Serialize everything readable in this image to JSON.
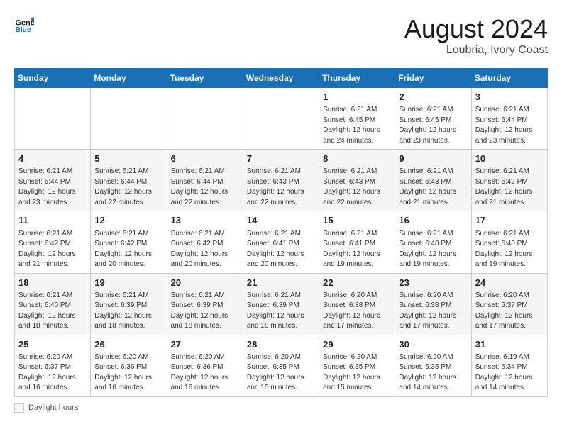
{
  "header": {
    "logo_line1": "General",
    "logo_line2": "Blue",
    "month_year": "August 2024",
    "location": "Loubria, Ivory Coast"
  },
  "days_of_week": [
    "Sunday",
    "Monday",
    "Tuesday",
    "Wednesday",
    "Thursday",
    "Friday",
    "Saturday"
  ],
  "weeks": [
    [
      {
        "day": "",
        "info": ""
      },
      {
        "day": "",
        "info": ""
      },
      {
        "day": "",
        "info": ""
      },
      {
        "day": "",
        "info": ""
      },
      {
        "day": "1",
        "info": "Sunrise: 6:21 AM\nSunset: 6:45 PM\nDaylight: 12 hours\nand 24 minutes."
      },
      {
        "day": "2",
        "info": "Sunrise: 6:21 AM\nSunset: 6:45 PM\nDaylight: 12 hours\nand 23 minutes."
      },
      {
        "day": "3",
        "info": "Sunrise: 6:21 AM\nSunset: 6:44 PM\nDaylight: 12 hours\nand 23 minutes."
      }
    ],
    [
      {
        "day": "4",
        "info": "Sunrise: 6:21 AM\nSunset: 6:44 PM\nDaylight: 12 hours\nand 23 minutes."
      },
      {
        "day": "5",
        "info": "Sunrise: 6:21 AM\nSunset: 6:44 PM\nDaylight: 12 hours\nand 22 minutes."
      },
      {
        "day": "6",
        "info": "Sunrise: 6:21 AM\nSunset: 6:44 PM\nDaylight: 12 hours\nand 22 minutes."
      },
      {
        "day": "7",
        "info": "Sunrise: 6:21 AM\nSunset: 6:43 PM\nDaylight: 12 hours\nand 22 minutes."
      },
      {
        "day": "8",
        "info": "Sunrise: 6:21 AM\nSunset: 6:43 PM\nDaylight: 12 hours\nand 22 minutes."
      },
      {
        "day": "9",
        "info": "Sunrise: 6:21 AM\nSunset: 6:43 PM\nDaylight: 12 hours\nand 21 minutes."
      },
      {
        "day": "10",
        "info": "Sunrise: 6:21 AM\nSunset: 6:42 PM\nDaylight: 12 hours\nand 21 minutes."
      }
    ],
    [
      {
        "day": "11",
        "info": "Sunrise: 6:21 AM\nSunset: 6:42 PM\nDaylight: 12 hours\nand 21 minutes."
      },
      {
        "day": "12",
        "info": "Sunrise: 6:21 AM\nSunset: 6:42 PM\nDaylight: 12 hours\nand 20 minutes."
      },
      {
        "day": "13",
        "info": "Sunrise: 6:21 AM\nSunset: 6:42 PM\nDaylight: 12 hours\nand 20 minutes."
      },
      {
        "day": "14",
        "info": "Sunrise: 6:21 AM\nSunset: 6:41 PM\nDaylight: 12 hours\nand 20 minutes."
      },
      {
        "day": "15",
        "info": "Sunrise: 6:21 AM\nSunset: 6:41 PM\nDaylight: 12 hours\nand 19 minutes."
      },
      {
        "day": "16",
        "info": "Sunrise: 6:21 AM\nSunset: 6:40 PM\nDaylight: 12 hours\nand 19 minutes."
      },
      {
        "day": "17",
        "info": "Sunrise: 6:21 AM\nSunset: 6:40 PM\nDaylight: 12 hours\nand 19 minutes."
      }
    ],
    [
      {
        "day": "18",
        "info": "Sunrise: 6:21 AM\nSunset: 6:40 PM\nDaylight: 12 hours\nand 18 minutes."
      },
      {
        "day": "19",
        "info": "Sunrise: 6:21 AM\nSunset: 6:39 PM\nDaylight: 12 hours\nand 18 minutes."
      },
      {
        "day": "20",
        "info": "Sunrise: 6:21 AM\nSunset: 6:39 PM\nDaylight: 12 hours\nand 18 minutes."
      },
      {
        "day": "21",
        "info": "Sunrise: 6:21 AM\nSunset: 6:39 PM\nDaylight: 12 hours\nand 18 minutes."
      },
      {
        "day": "22",
        "info": "Sunrise: 6:20 AM\nSunset: 6:38 PM\nDaylight: 12 hours\nand 17 minutes."
      },
      {
        "day": "23",
        "info": "Sunrise: 6:20 AM\nSunset: 6:38 PM\nDaylight: 12 hours\nand 17 minutes."
      },
      {
        "day": "24",
        "info": "Sunrise: 6:20 AM\nSunset: 6:37 PM\nDaylight: 12 hours\nand 17 minutes."
      }
    ],
    [
      {
        "day": "25",
        "info": "Sunrise: 6:20 AM\nSunset: 6:37 PM\nDaylight: 12 hours\nand 16 minutes."
      },
      {
        "day": "26",
        "info": "Sunrise: 6:20 AM\nSunset: 6:36 PM\nDaylight: 12 hours\nand 16 minutes."
      },
      {
        "day": "27",
        "info": "Sunrise: 6:20 AM\nSunset: 6:36 PM\nDaylight: 12 hours\nand 16 minutes."
      },
      {
        "day": "28",
        "info": "Sunrise: 6:20 AM\nSunset: 6:35 PM\nDaylight: 12 hours\nand 15 minutes."
      },
      {
        "day": "29",
        "info": "Sunrise: 6:20 AM\nSunset: 6:35 PM\nDaylight: 12 hours\nand 15 minutes."
      },
      {
        "day": "30",
        "info": "Sunrise: 6:20 AM\nSunset: 6:35 PM\nDaylight: 12 hours\nand 14 minutes."
      },
      {
        "day": "31",
        "info": "Sunrise: 6:19 AM\nSunset: 6:34 PM\nDaylight: 12 hours\nand 14 minutes."
      }
    ]
  ],
  "footer": {
    "label": "Daylight hours"
  }
}
